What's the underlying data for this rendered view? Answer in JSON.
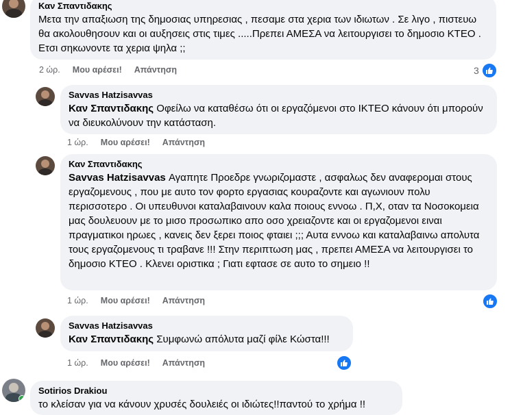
{
  "comments": [
    {
      "author": "Καν Σπαντιδακης",
      "text": "Μετα την απαξιωση της δημοσιας υπηρεσιας , πεσαμε στα χερια των ιδιωτων . Σε λιγο , πιστευω θα ακολουθησουν και οι αυξησεις στις τιμες .....Πρεπει ΑΜΕΣΑ να λειτουργισει το δημοσιο ΚΤΕΟ . Ετσι σηκωνοντε τα χερια ψηλα ;;",
      "time": "2 ώρ.",
      "like_label": "Μου αρέσει!",
      "reply_label": "Απάντηση",
      "reaction_count": "3"
    },
    {
      "author": "Savvas Hatzisavvas",
      "mention": "Καν Σπαντιδακης",
      "text": " Οφείλω να καταθέσω ότι οι εργαζόμενοι στο ΙΚΤΕΟ κάνουν ότι μπορούν να διευκολύνουν την κατάσταση.",
      "time": "1 ώρ.",
      "like_label": "Μου αρέσει!",
      "reply_label": "Απάντηση"
    },
    {
      "author": "Καν Σπαντιδακης",
      "mention": "Savvas Hatzisavvas",
      "text": " Αγαπητε Προεδρε γνωριζομαστε , ασφαλως δεν αναφερομαι στους εργαζομενους , που με αυτο τον φορτο εργασιας κουραζοντε και αγωνιουν πολυ περισσοτερο . Οι υπευθυνοι καταλαβαινουν καλα ποιους εννοω . Π,Χ, οταν τα Νοσοκομεια μας δουλευουν με το μισο προσωπικο απο οσο χρειαζοντε και οι εργαζομενοι ειναι πραγματικοι ηρωες , κανεις δεν ξερει ποιος φταιει ;;; Αυτα εννοω και καταλαβαινω απολυτα τους εργαζομενους τι τραβανε !!! Στην περιπτωση μας , πρεπει ΑΜΕΣΑ να λειτουργισει το δημοσιο ΚΤΕΟ . Κλενει οριστικα ; Γιατι εφτασε σε αυτο το σημειο !!",
      "time": "1 ώρ.",
      "like_label": "Μου αρέσει!",
      "reply_label": "Απάντηση"
    },
    {
      "author": "Savvas Hatzisavvas",
      "mention": "Καν Σπαντιδακης",
      "text": " Συμφωνώ απόλυτα μαζί φίλε Κώστα!!!",
      "time": "1 ώρ.",
      "like_label": "Μου αρέσει!",
      "reply_label": "Απάντηση"
    },
    {
      "author": "Sotirios Drakiou",
      "text": "το κλείσαν για να κάνουν χρυσές δουλειές οι ιδιώτες!!παντού το χρήμα !!"
    }
  ],
  "icons": {
    "like": "thumbs-up-icon"
  },
  "colors": {
    "accent": "#1877f2",
    "bubble": "#f0f2f5",
    "meta": "#65676b"
  }
}
